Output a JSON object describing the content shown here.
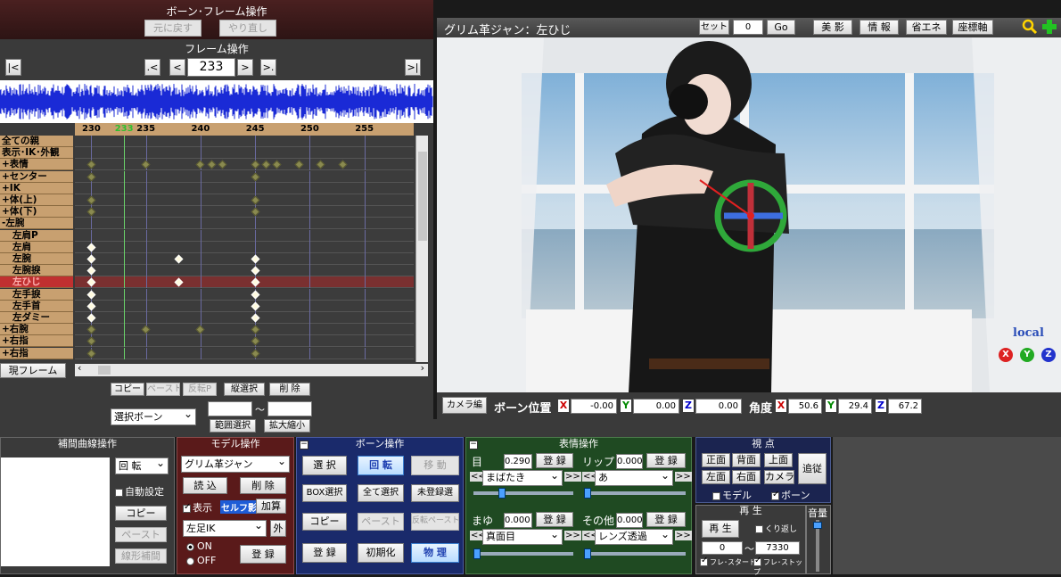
{
  "bone_frame": {
    "title": "ボーン･フレーム操作",
    "undo_label": "元に戻す",
    "redo_label": "やり直し",
    "frame_ops_title": "フレーム操作",
    "first_label": "|<",
    "prev_key_label": ".<",
    "prev_label": "<",
    "frame_value": "233",
    "next_label": ">",
    "next_key_label": ">.",
    "last_label": ">|"
  },
  "timeline": {
    "ruler": [
      "230",
      "233",
      "235",
      "240",
      "245",
      "250",
      "255"
    ],
    "tracks": [
      "全ての親",
      "表示･IK･外観",
      "+表情",
      "+センター",
      "+IK",
      "+体(上)",
      "+体(下)",
      "-左腕",
      "左肩P",
      "左肩",
      "左腕",
      "左腕捩",
      "左ひじ",
      "左手捩",
      "左手首",
      "左ダミー",
      "+右腕",
      "+右指",
      "+右指"
    ],
    "selected_track": "左ひじ",
    "current_frame_label": "現フレーム"
  },
  "edit_ops": {
    "copy": "コピー",
    "paste": "ペースト",
    "reverse_paste": "反転P",
    "vertical_select": "縦選択",
    "delete": "削 除",
    "select_bone": "選択ボーン",
    "range_from": "",
    "range_to": "",
    "tilde": "～",
    "range_select": "範囲選択",
    "scale": "拡大縮小"
  },
  "viewport": {
    "title": "グリム革ジャン：左ひじ",
    "set_label": "セット",
    "set_value": "0",
    "go_label": "Go",
    "beauty": "美 影",
    "info": "情 報",
    "power_save": "省エネ",
    "axis": "座標軸",
    "local_label": "local",
    "xyz": [
      "X",
      "Y",
      "Z"
    ]
  },
  "bone_position": {
    "camera_button": "カメラ編",
    "position_label": "ボーン位置",
    "x_label": "X",
    "x": "-0.00",
    "y_label": "Y",
    "y": "0.00",
    "z_label": "Z",
    "z": "0.00",
    "angle_label": "角度",
    "ax": "50.6",
    "ay": "29.4",
    "az": "67.2"
  },
  "interp": {
    "title": "補間曲線操作",
    "rotate": "回 転",
    "auto_setting": "自動設定",
    "copy": "コピー",
    "paste": "ペースト",
    "linear": "線形補間"
  },
  "model_ops": {
    "title": "モデル操作",
    "model_name": "グリム革ジャン",
    "load": "読 込",
    "delete": "削 除",
    "display": "表示",
    "self_shadow": "セルフ影",
    "add": "加算",
    "ik_bone": "左足IK",
    "outer": "外",
    "on": "ON",
    "off": "OFF",
    "register": "登 録"
  },
  "bone_ops": {
    "title": "ボーン操作",
    "select": "選 択",
    "rotate": "回 転",
    "move": "移 動",
    "box_select": "BOX選択",
    "select_all": "全て選択",
    "unregistered": "未登録選",
    "copy": "コピー",
    "paste": "ペースト",
    "reverse_paste": "反転ペースト",
    "register": "登 録",
    "initialize": "初期化",
    "physics": "物 理"
  },
  "morph_ops": {
    "title": "表情操作",
    "eye_label": "目",
    "eye_value": "0.290",
    "eye_morph": "まばたき",
    "lip_label": "リップ",
    "lip_value": "0.000",
    "lip_morph": "あ",
    "brow_label": "まゆ",
    "brow_value": "0.000",
    "brow_morph": "真面目",
    "other_label": "その他",
    "other_value": "0.000",
    "other_morph": "レンズ透過",
    "register": "登 録",
    "left_arrows": "<<",
    "right_arrows": ">>"
  },
  "view_ops": {
    "title": "視 点",
    "front": "正面",
    "back": "背面",
    "top": "上面",
    "left": "左面",
    "right": "右面",
    "camera": "カメラ",
    "follow": "追従",
    "model_chk": "モデル",
    "bone_chk": "ボーン"
  },
  "playback": {
    "title": "再 生",
    "play": "再 生",
    "repeat": "くり返し",
    "start": "0",
    "tilde": "～",
    "end": "7330",
    "frame_start": "フレ･スタート",
    "frame_stop": "フレ･ストップ"
  },
  "volume": {
    "title": "音量"
  },
  "colors": {
    "panel_dark": "#3b3b3b",
    "model_panel": "#5a1a1a",
    "bone_panel": "#1a2a6b",
    "morph_panel": "#1f4a22",
    "view_panel": "#1b2450",
    "accent_blue": "#1e5cd6"
  }
}
